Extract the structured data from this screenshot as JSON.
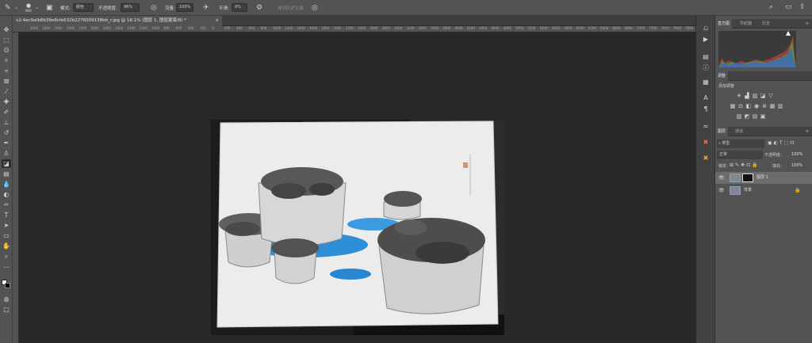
{
  "app": {
    "accent": "#535353",
    "canvas_bg": "#282828"
  },
  "options_bar": {
    "mode_label": "模式:",
    "mode_value": "颜色",
    "opacity_label": "不透明度:",
    "opacity_value": "96%",
    "flow_label": "流量:",
    "flow_value": "100%",
    "smooth_label": "平滑:",
    "smooth_value": "0%",
    "brush_size": "800",
    "erase_history_label": "抹到历史记录"
  },
  "document": {
    "tab_title": "v2-4ec9afb8b39e8cfe632b2276009138bb_r.jpg @ 18.1% (图层 1, 图层蒙版/8) *"
  },
  "ruler": {
    "ticks": [
      "3000",
      "2800",
      "2600",
      "2400",
      "2200",
      "2000",
      "1800",
      "1600",
      "1400",
      "1200",
      "1000",
      "800",
      "600",
      "400",
      "200",
      "0",
      "200",
      "400",
      "600",
      "800",
      "1000",
      "1200",
      "1400",
      "1600",
      "1800",
      "2000",
      "2200",
      "2400",
      "2600",
      "2800",
      "3000",
      "3200",
      "3400",
      "3600",
      "3800",
      "4000",
      "4200",
      "4400",
      "4600",
      "4800",
      "5000",
      "5200",
      "5400",
      "5600",
      "5800",
      "6000",
      "6200",
      "6400",
      "6600",
      "6800",
      "7000",
      "7200",
      "7400",
      "7600",
      "7800"
    ]
  },
  "panels": {
    "top_tabs": [
      "直方图",
      "导航器",
      "历史"
    ],
    "adjust_title": "调整",
    "adjust_subtitle": "添加调整",
    "layer_tabs": [
      "图层",
      "通道"
    ],
    "filter_kind": "类型",
    "blend_mode": "正常",
    "opacity_label": "不透明度:",
    "opacity_value": "100%",
    "lock_label": "锁定:",
    "fill_label": "填充:",
    "fill_value": "100%",
    "layers": [
      {
        "name": "图层 1"
      },
      {
        "name": "背景"
      }
    ]
  }
}
